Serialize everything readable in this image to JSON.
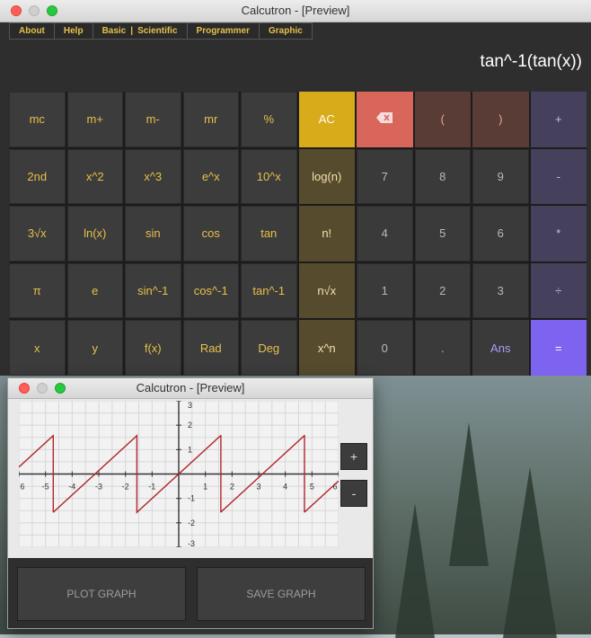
{
  "main_window": {
    "title": "Calcutron - [Preview]",
    "menu": [
      "About",
      "Help",
      "Basic",
      "|",
      "Scientific",
      "Programmer",
      "Graphic"
    ],
    "display": "tan^-1(tan(x))",
    "keys": [
      {
        "label": "mc",
        "kind": "fn"
      },
      {
        "label": "m+",
        "kind": "fn"
      },
      {
        "label": "m-",
        "kind": "fn"
      },
      {
        "label": "mr",
        "kind": "fn"
      },
      {
        "label": "%",
        "kind": "fn"
      },
      {
        "label": "AC",
        "kind": "ac"
      },
      {
        "label": "",
        "kind": "del",
        "icon": "backspace-icon"
      },
      {
        "label": "(",
        "kind": "paren"
      },
      {
        "label": ")",
        "kind": "paren"
      },
      {
        "label": "+",
        "kind": "op"
      },
      {
        "label": "2nd",
        "kind": "fn"
      },
      {
        "label": "x^2",
        "kind": "fn"
      },
      {
        "label": "x^3",
        "kind": "fn"
      },
      {
        "label": "e^x",
        "kind": "fn"
      },
      {
        "label": "10^x",
        "kind": "fn"
      },
      {
        "label": "log(n)",
        "kind": "log"
      },
      {
        "label": "7",
        "kind": "num"
      },
      {
        "label": "8",
        "kind": "num"
      },
      {
        "label": "9",
        "kind": "num"
      },
      {
        "label": "-",
        "kind": "op"
      },
      {
        "label": "3√x",
        "kind": "fn"
      },
      {
        "label": "ln(x)",
        "kind": "fn"
      },
      {
        "label": "sin",
        "kind": "fn"
      },
      {
        "label": "cos",
        "kind": "fn"
      },
      {
        "label": "tan",
        "kind": "fn"
      },
      {
        "label": "n!",
        "kind": "log"
      },
      {
        "label": "4",
        "kind": "num"
      },
      {
        "label": "5",
        "kind": "num"
      },
      {
        "label": "6",
        "kind": "num"
      },
      {
        "label": "*",
        "kind": "op"
      },
      {
        "label": "π",
        "kind": "fn"
      },
      {
        "label": "e",
        "kind": "fn"
      },
      {
        "label": "sin^-1",
        "kind": "fn"
      },
      {
        "label": "cos^-1",
        "kind": "fn"
      },
      {
        "label": "tan^-1",
        "kind": "fn"
      },
      {
        "label": "n√x",
        "kind": "log"
      },
      {
        "label": "1",
        "kind": "num"
      },
      {
        "label": "2",
        "kind": "num"
      },
      {
        "label": "3",
        "kind": "num"
      },
      {
        "label": "÷",
        "kind": "op"
      },
      {
        "label": "x",
        "kind": "fn"
      },
      {
        "label": "y",
        "kind": "fn"
      },
      {
        "label": "f(x)",
        "kind": "fn"
      },
      {
        "label": "Rad",
        "kind": "fn"
      },
      {
        "label": "Deg",
        "kind": "fn"
      },
      {
        "label": "x^n",
        "kind": "log"
      },
      {
        "label": "0",
        "kind": "num"
      },
      {
        "label": ".",
        "kind": "num"
      },
      {
        "label": "Ans",
        "kind": "ans"
      },
      {
        "label": "=",
        "kind": "eq"
      }
    ]
  },
  "graph_window": {
    "title": "Calcutron - [Preview]",
    "zoom_in": "+",
    "zoom_out": "-",
    "plot_button": "PLOT GRAPH",
    "save_button": "SAVE GRAPH",
    "chart_data": {
      "type": "line",
      "function": "tan^-1(tan(x))",
      "xlim": [
        -6,
        6
      ],
      "ylim": [
        -3,
        3
      ],
      "x_ticks": [
        "6",
        "-5",
        "-4",
        "-3",
        "-2",
        "-1",
        "1",
        "2",
        "3",
        "4",
        "5",
        "6"
      ],
      "y_ticks": [
        "3",
        "2",
        "1",
        "-1",
        "-2",
        "-3"
      ],
      "grid": true,
      "line_color": "#b0252b"
    }
  }
}
